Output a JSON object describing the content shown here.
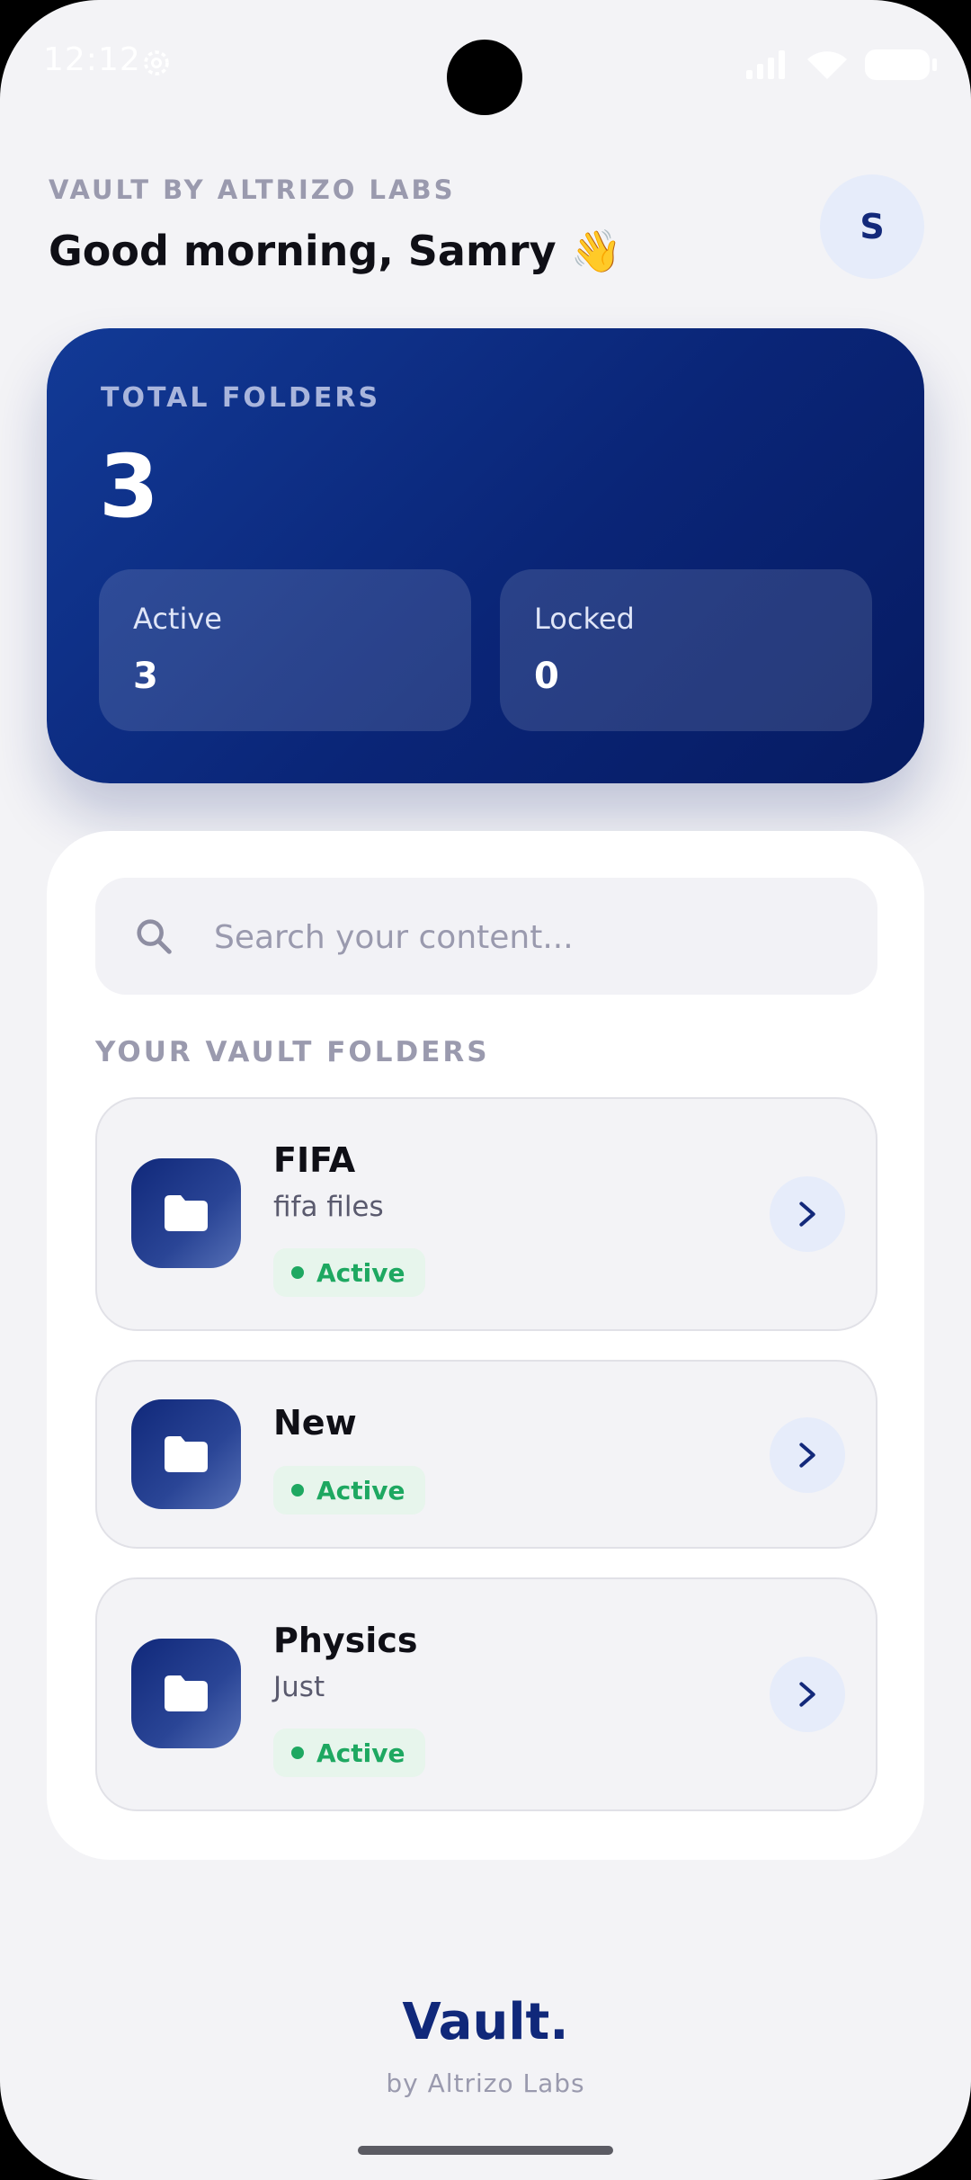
{
  "status_bar": {
    "time": "12:12"
  },
  "header": {
    "eyebrow": "VAULT BY ALTRIZO LABS",
    "greeting": "Good morning, Samry 👋",
    "avatar_initial": "S"
  },
  "summary": {
    "label": "TOTAL FOLDERS",
    "total": "3",
    "active_label": "Active",
    "active_value": "3",
    "locked_label": "Locked",
    "locked_value": "0"
  },
  "search": {
    "placeholder": "Search your content..."
  },
  "folders_section": {
    "title": "YOUR VAULT FOLDERS",
    "items": [
      {
        "name": "FIFA",
        "description": "fifa files",
        "status": "Active"
      },
      {
        "name": "New",
        "description": "",
        "status": "Active"
      },
      {
        "name": "Physics",
        "description": "Just",
        "status": "Active"
      }
    ]
  },
  "footer": {
    "brand": "Vault.",
    "byline": "by Altrizo Labs"
  },
  "colors": {
    "accent": "#10287a",
    "card_gradient_start": "#123a96",
    "card_gradient_end": "#061b62",
    "status_green": "#1ea861"
  }
}
